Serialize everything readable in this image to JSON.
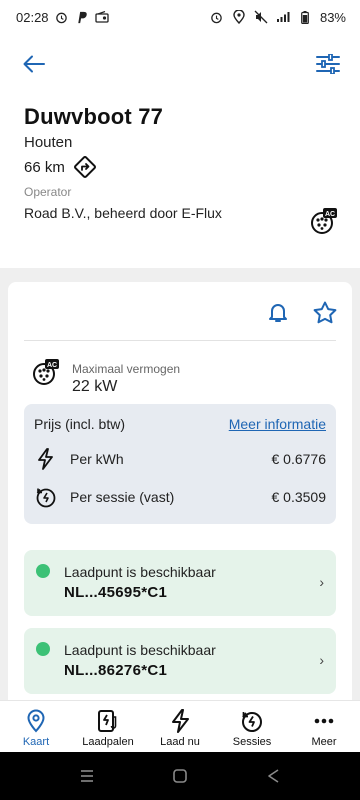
{
  "status_bar": {
    "time": "02:28",
    "battery": "83%",
    "left_icons": [
      "alarm-icon",
      "paypal-icon",
      "radio-icon"
    ],
    "right_icons": [
      "alarm-icon",
      "location-icon",
      "mute-icon",
      "signal-icon",
      "battery-icon"
    ]
  },
  "topbar": {
    "back_icon": "arrow-left-icon",
    "filter_icon": "sliders-icon"
  },
  "station": {
    "name": "Duwvboot 77",
    "city": "Houten",
    "distance": "66 km",
    "operator_label": "Operator",
    "operator": "Road B.V., beheerd door E-Flux",
    "plug_badge": "AC"
  },
  "details": {
    "power_label": "Maximaal vermogen",
    "power_value": "22 kW",
    "price": {
      "title": "Prijs (incl. btw)",
      "more_info": "Meer informatie",
      "rows": [
        {
          "icon": "bolt-icon",
          "label": "Per kWh",
          "value": "€ 0.6776"
        },
        {
          "icon": "session-clock-icon",
          "label": "Per sessie (vast)",
          "value": "€ 0.3509"
        }
      ]
    },
    "connectors": [
      {
        "status": "Laadpunt is beschikbaar",
        "id": "NL...45695*C1",
        "status_color": "#3cc176"
      },
      {
        "status": "Laadpunt is beschikbaar",
        "id": "NL...86276*C1",
        "status_color": "#3cc176"
      }
    ]
  },
  "tabs": [
    {
      "label": "Kaart",
      "icon": "map-pin-icon",
      "active": true
    },
    {
      "label": "Laadpalen",
      "icon": "charger-icon",
      "active": false
    },
    {
      "label": "Laad nu",
      "icon": "bolt-icon",
      "active": false
    },
    {
      "label": "Sessies",
      "icon": "session-icon",
      "active": false
    },
    {
      "label": "Meer",
      "icon": "more-dots-icon",
      "active": false
    }
  ],
  "colors": {
    "accent": "#1f66b4",
    "available": "#3cc176",
    "status_card_bg": "#e5f3ea",
    "price_box_bg": "#e7ebf1",
    "page_bg": "#efefef"
  }
}
